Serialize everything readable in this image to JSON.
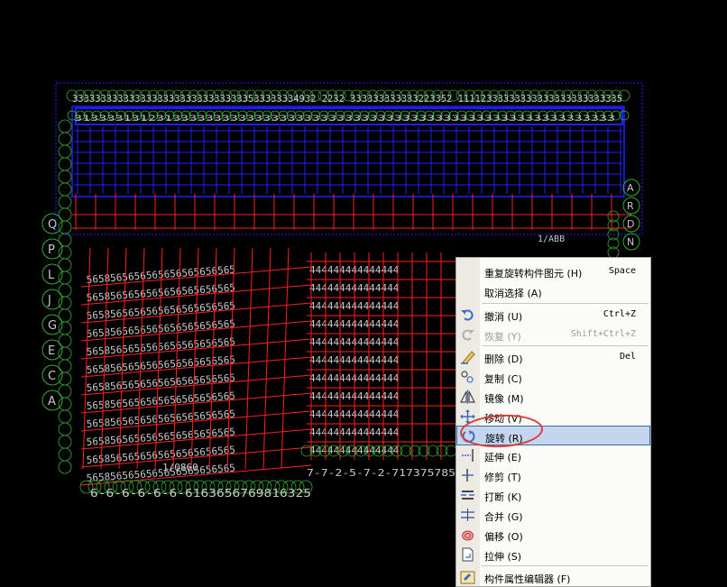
{
  "drawing": {
    "top_labels": "3333333333333333333333333333333533333334932 2232 333333333333223352 11112333333333333333333333335",
    "second_row": "313333131231333333333333333333333333333333333333333333333333333333",
    "left_axis": [
      "Q",
      "P",
      "L",
      "J",
      "G",
      "E",
      "C",
      "A"
    ],
    "right_axis": [
      "A",
      "R",
      "D",
      "N"
    ],
    "bottom_labels": "6-6-6-6-6-6-6163656769816325",
    "mid_right_labels": "7-7-2-5-7-2-717375785",
    "badge_text": "1/0860",
    "right_text_1": "1/ABB"
  },
  "context_menu": {
    "items": [
      {
        "label": "重复旋转构件图元",
        "key": "H",
        "shortcut": "Space",
        "icon": "none-icon"
      },
      {
        "label": "取消选择",
        "key": "A",
        "shortcut": "",
        "icon": "none-icon"
      },
      {
        "label": "撤消",
        "key": "U",
        "shortcut": "Ctrl+Z",
        "icon": "undo-icon"
      },
      {
        "label": "恢复",
        "key": "Y",
        "shortcut": "Shift+Ctrl+Z",
        "icon": "redo-icon",
        "disabled": true
      },
      {
        "label": "删除",
        "key": "D",
        "shortcut": "Del",
        "icon": "eraser-icon"
      },
      {
        "label": "复制",
        "key": "C",
        "shortcut": "",
        "icon": "copy-icon"
      },
      {
        "label": "镜像",
        "key": "M",
        "shortcut": "",
        "icon": "mirror-icon"
      },
      {
        "label": "移动",
        "key": "V",
        "shortcut": "",
        "icon": "move-icon"
      },
      {
        "label": "旋转",
        "key": "R",
        "shortcut": "",
        "icon": "rotate-icon",
        "active": true
      },
      {
        "label": "延伸",
        "key": "E",
        "shortcut": "",
        "icon": "extend-icon"
      },
      {
        "label": "修剪",
        "key": "T",
        "shortcut": "",
        "icon": "trim-icon"
      },
      {
        "label": "打断",
        "key": "K",
        "shortcut": "",
        "icon": "break-icon"
      },
      {
        "label": "合并",
        "key": "G",
        "shortcut": "",
        "icon": "merge-icon"
      },
      {
        "label": "偏移",
        "key": "O",
        "shortcut": "",
        "icon": "offset-icon"
      },
      {
        "label": "拉伸",
        "key": "S",
        "shortcut": "",
        "icon": "stretch-icon"
      },
      {
        "label": "构件属性编辑器",
        "key": "F",
        "shortcut": "",
        "icon": "properties-icon"
      }
    ],
    "display": [
      "重复旋转构件图元 (H)",
      "取消选择 (A)",
      "撤消 (U)",
      "恢复 (Y)",
      "删除 (D)",
      "复制 (C)",
      "镜像 (M)",
      "移动 (V)",
      "旋转 (R)",
      "延伸 (E)",
      "修剪 (T)",
      "打断 (K)",
      "合并 (G)",
      "偏移 (O)",
      "拉伸 (S)",
      "构件属性编辑器 (F)"
    ]
  },
  "colors": {
    "background": "#000000",
    "grid_blue": "#2020ff",
    "grid_red": "#ff2020",
    "axis_green": "#2fae2f",
    "label_grey": "#c8c8c8",
    "menu_highlight": "#c3d6ee",
    "annotation_red": "#e03a34"
  }
}
